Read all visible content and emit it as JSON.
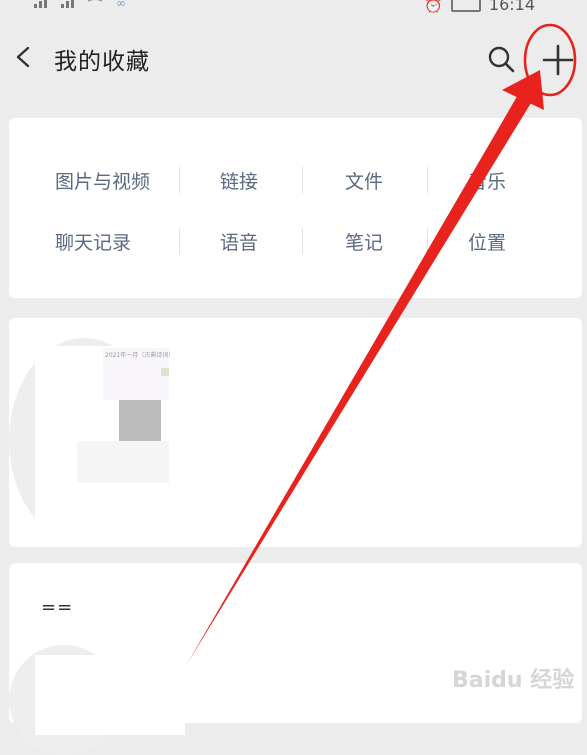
{
  "status_bar": {
    "time": "16:14"
  },
  "header": {
    "title": "我的收藏"
  },
  "categories": {
    "row1": [
      "图片与视频",
      "链接",
      "文件",
      "音乐"
    ],
    "row2": [
      "聊天记录",
      "语音",
      "笔记",
      "位置"
    ]
  },
  "items": [
    {
      "thumbnail_caption": "2021年一月（古典诗词）"
    },
    {
      "preview_text": "=="
    }
  ],
  "watermark": "Baidu 经验",
  "annotation": {
    "color": "#e8231e"
  }
}
